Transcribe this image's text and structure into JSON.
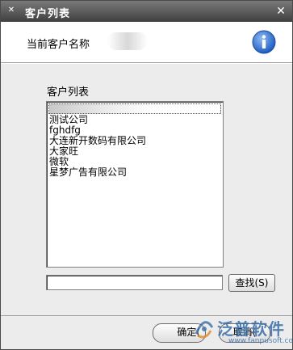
{
  "window": {
    "title": "客户列表"
  },
  "header": {
    "current_label": "当前客户名称"
  },
  "list": {
    "label": "客户列表",
    "items": [
      "",
      "测试公司",
      "fghdfg",
      "大连新开数码有限公司",
      "大家旺",
      "微软",
      "星梦广告有限公司"
    ]
  },
  "search": {
    "value": "",
    "button_label": "查找(S)"
  },
  "footer": {
    "ok_label": "确定(",
    "cancel_label": "取消("
  },
  "watermark": {
    "text": "泛普软件",
    "url": "www.fanpusoft.com"
  },
  "colors": {
    "titlebar": "#3f3f3f",
    "info_icon": "#2f6fd0",
    "watermark": "#3a6ea8"
  }
}
